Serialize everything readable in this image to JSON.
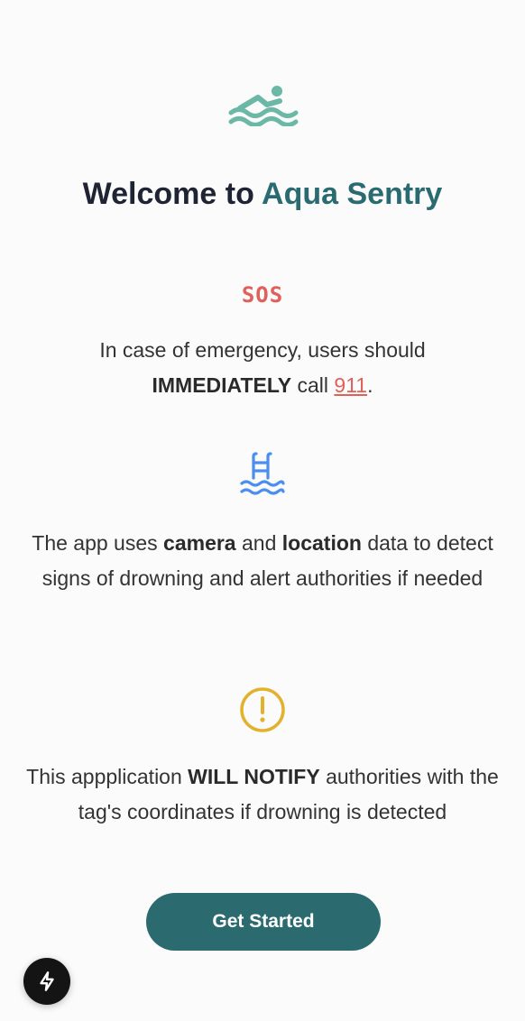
{
  "header": {
    "logo_icon": "swimmer-icon",
    "title_prefix": "Welcome to",
    "title_brand": "Aqua Sentry"
  },
  "emergency": {
    "badge": "SOS",
    "text_before": "In case of emergency, users should",
    "text_strong": "IMMEDIATELY",
    "text_mid": "call",
    "phone": "911",
    "text_after": "."
  },
  "data_usage": {
    "icon": "pool-ladder-icon",
    "t1": "The app uses",
    "camera": "camera",
    "t2": "and",
    "location": "location",
    "t3": "data to detect signs of drowning and alert authorities if needed"
  },
  "notice": {
    "icon": "warning-icon",
    "t1": "This appplication",
    "strong": "WILL NOTIFY",
    "t2": "authorities with the tag's coordinates if drowning is detected"
  },
  "cta": {
    "label": "Get Started"
  },
  "fab": {
    "icon": "bolt-icon"
  },
  "colors": {
    "brand": "#2a6b71",
    "sos": "#e0605a",
    "pool_icon": "#4a8ff0",
    "warning": "#e2b22c",
    "logo": "#6bb8a6"
  }
}
